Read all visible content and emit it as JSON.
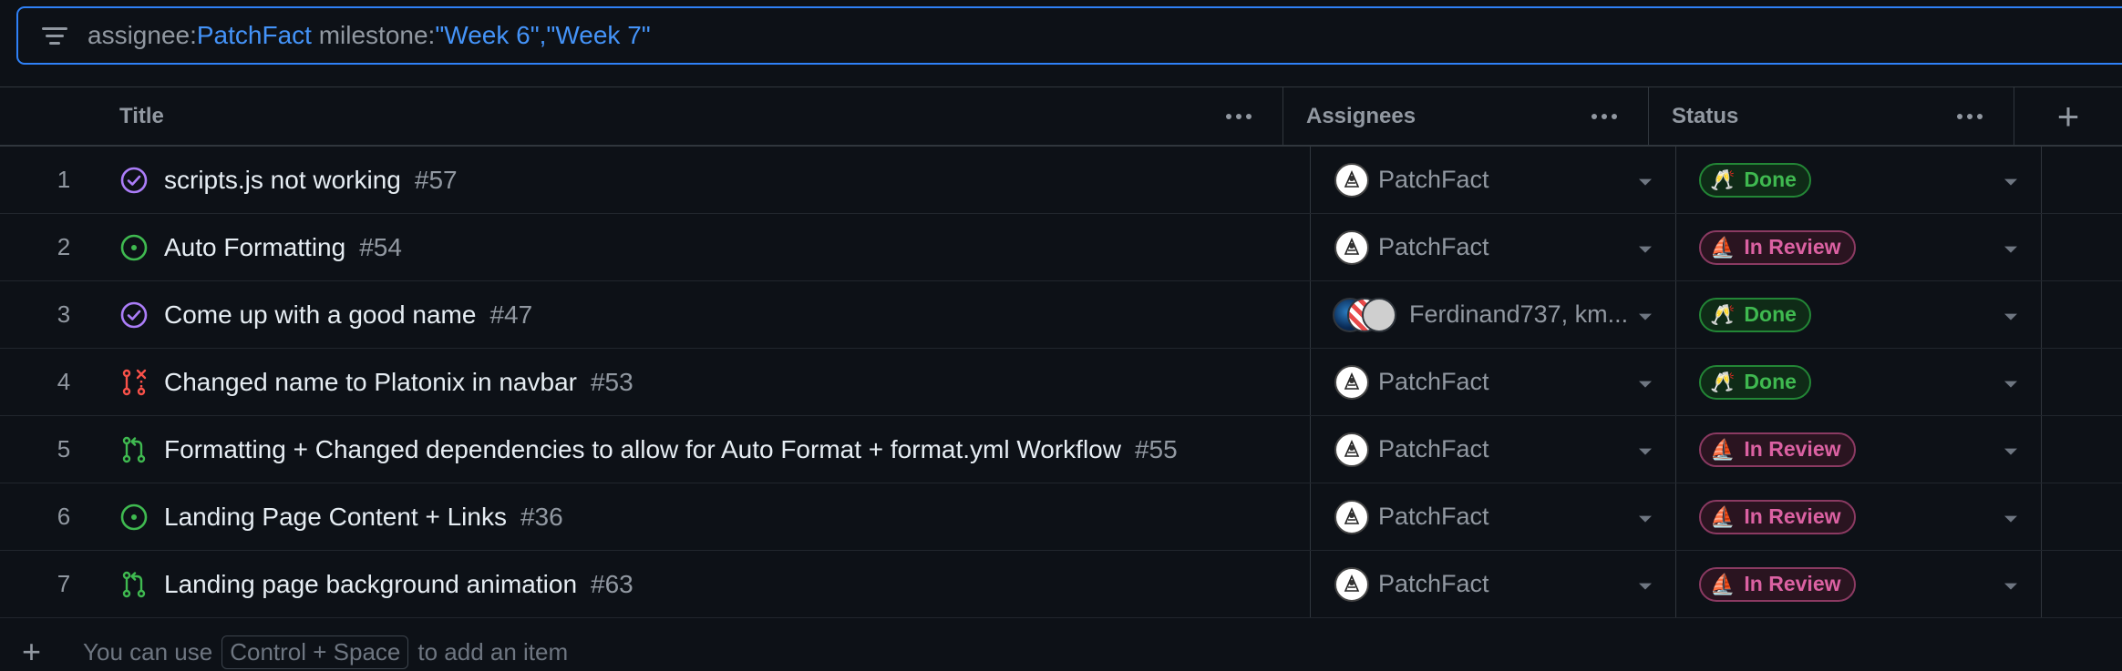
{
  "filter": {
    "parts": [
      {
        "text": "assignee:",
        "kind": "key"
      },
      {
        "text": "PatchFact",
        "kind": "val"
      },
      {
        "text": " milestone:",
        "kind": "key"
      },
      {
        "text": "\"Week 6\",\"Week 7\"",
        "kind": "val"
      }
    ]
  },
  "columns": {
    "title": "Title",
    "assignees": "Assignees",
    "status": "Status"
  },
  "rows": [
    {
      "num": "1",
      "icon": "closed-issue-icon",
      "title": "scripts.js not working",
      "ref": "#57",
      "assignee": "PatchFact",
      "status": "Done"
    },
    {
      "num": "2",
      "icon": "open-issue-icon",
      "title": "Auto Formatting",
      "ref": "#54",
      "assignee": "PatchFact",
      "status": "In Review"
    },
    {
      "num": "3",
      "icon": "closed-issue-icon",
      "title": "Come up with a good name",
      "ref": "#47",
      "assignee": "Ferdinand737, km...",
      "status": "Done"
    },
    {
      "num": "4",
      "icon": "closed-pr-icon",
      "title": "Changed name to Platonix in navbar",
      "ref": "#53",
      "assignee": "PatchFact",
      "status": "Done"
    },
    {
      "num": "5",
      "icon": "open-pr-icon",
      "title": "Formatting + Changed dependencies to allow for Auto Format + format.yml Workflow",
      "ref": "#55",
      "assignee": "PatchFact",
      "status": "In Review"
    },
    {
      "num": "6",
      "icon": "open-issue-icon",
      "title": "Landing Page Content + Links",
      "ref": "#36",
      "assignee": "PatchFact",
      "status": "In Review"
    },
    {
      "num": "7",
      "icon": "open-pr-icon",
      "title": "Landing page background animation",
      "ref": "#63",
      "assignee": "PatchFact",
      "status": "In Review"
    }
  ],
  "footer": {
    "prefix": "You can use",
    "kbd": "Control + Space",
    "suffix": "to add an item"
  },
  "colors": {
    "done": "#3fb950",
    "in_review": "#db61a2",
    "accent": "#4493f8"
  }
}
